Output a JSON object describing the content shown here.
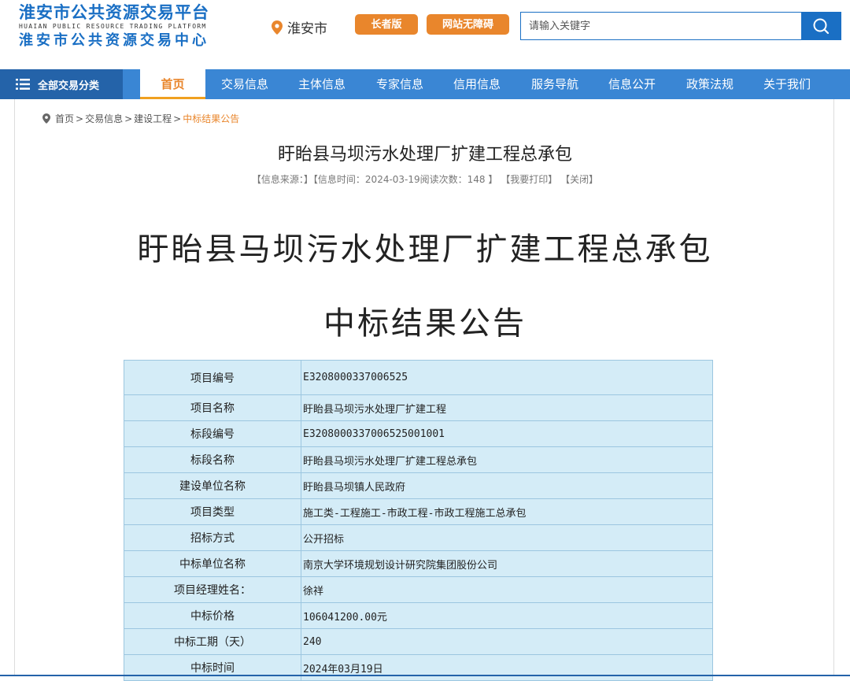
{
  "header": {
    "logo_main": "淮安市公共资源交易平台",
    "logo_en": "HUAIAN PUBLIC RESOURCE TRADING PLATFORM",
    "logo_sub": "淮安市公共资源交易中心",
    "city": "淮安市",
    "elder_btn": "长者版",
    "access_btn": "网站无障碍",
    "search_placeholder": "请输入关键字",
    "icons": {
      "city": "location-pin-icon",
      "search": "search-icon"
    },
    "colors": {
      "brand": "#1a6fc4",
      "accent": "#e9862c",
      "nav": "#3a86d4",
      "nav_dark": "#2463a9"
    }
  },
  "nav": {
    "all_label": "全部交易分类",
    "all_icon": "menu-list-icon",
    "items": [
      {
        "label": "首页",
        "active": true
      },
      {
        "label": "交易信息"
      },
      {
        "label": "主体信息"
      },
      {
        "label": "专家信息"
      },
      {
        "label": "信用信息"
      },
      {
        "label": "服务导航"
      },
      {
        "label": "信息公开"
      },
      {
        "label": "政策法规"
      },
      {
        "label": "关于我们"
      }
    ]
  },
  "breadcrumb": {
    "items": [
      "首页",
      "交易信息",
      "建设工程"
    ],
    "current": "中标结果公告",
    "sep": ">"
  },
  "article": {
    "title": "盱眙县马坝污水处理厂扩建工程总承包",
    "meta_source": "【信息来源：",
    "meta_source_end": "】【信息时间：2024-03-19阅读次数：148 】",
    "meta_print": "【我要打印】",
    "meta_close": "【关闭】",
    "doc_title_line1": "盱眙县马坝污水处理厂扩建工程总承包",
    "doc_title_line2": "中标结果公告"
  },
  "table": {
    "rows": [
      {
        "k": "项目编号",
        "v": "E3208000337006525"
      },
      {
        "k": "项目名称",
        "v": "盱眙县马坝污水处理厂扩建工程"
      },
      {
        "k": "标段编号",
        "v": "E3208000337006525001001"
      },
      {
        "k": "标段名称",
        "v": "盱眙县马坝污水处理厂扩建工程总承包"
      },
      {
        "k": "建设单位名称",
        "v": "盱眙县马坝镇人民政府"
      },
      {
        "k": "项目类型",
        "v": "施工类-工程施工-市政工程-市政工程施工总承包"
      },
      {
        "k": "招标方式",
        "v": "公开招标"
      },
      {
        "k": "中标单位名称",
        "v": "南京大学环境规划设计研究院集团股份公司"
      },
      {
        "k": "项目经理姓名：",
        "v": "徐祥"
      },
      {
        "k": "中标价格",
        "v": "106041200.00元"
      },
      {
        "k": "中标工期（天）",
        "v": "240"
      },
      {
        "k": "中标时间",
        "v": "2024年03月19日"
      }
    ]
  }
}
